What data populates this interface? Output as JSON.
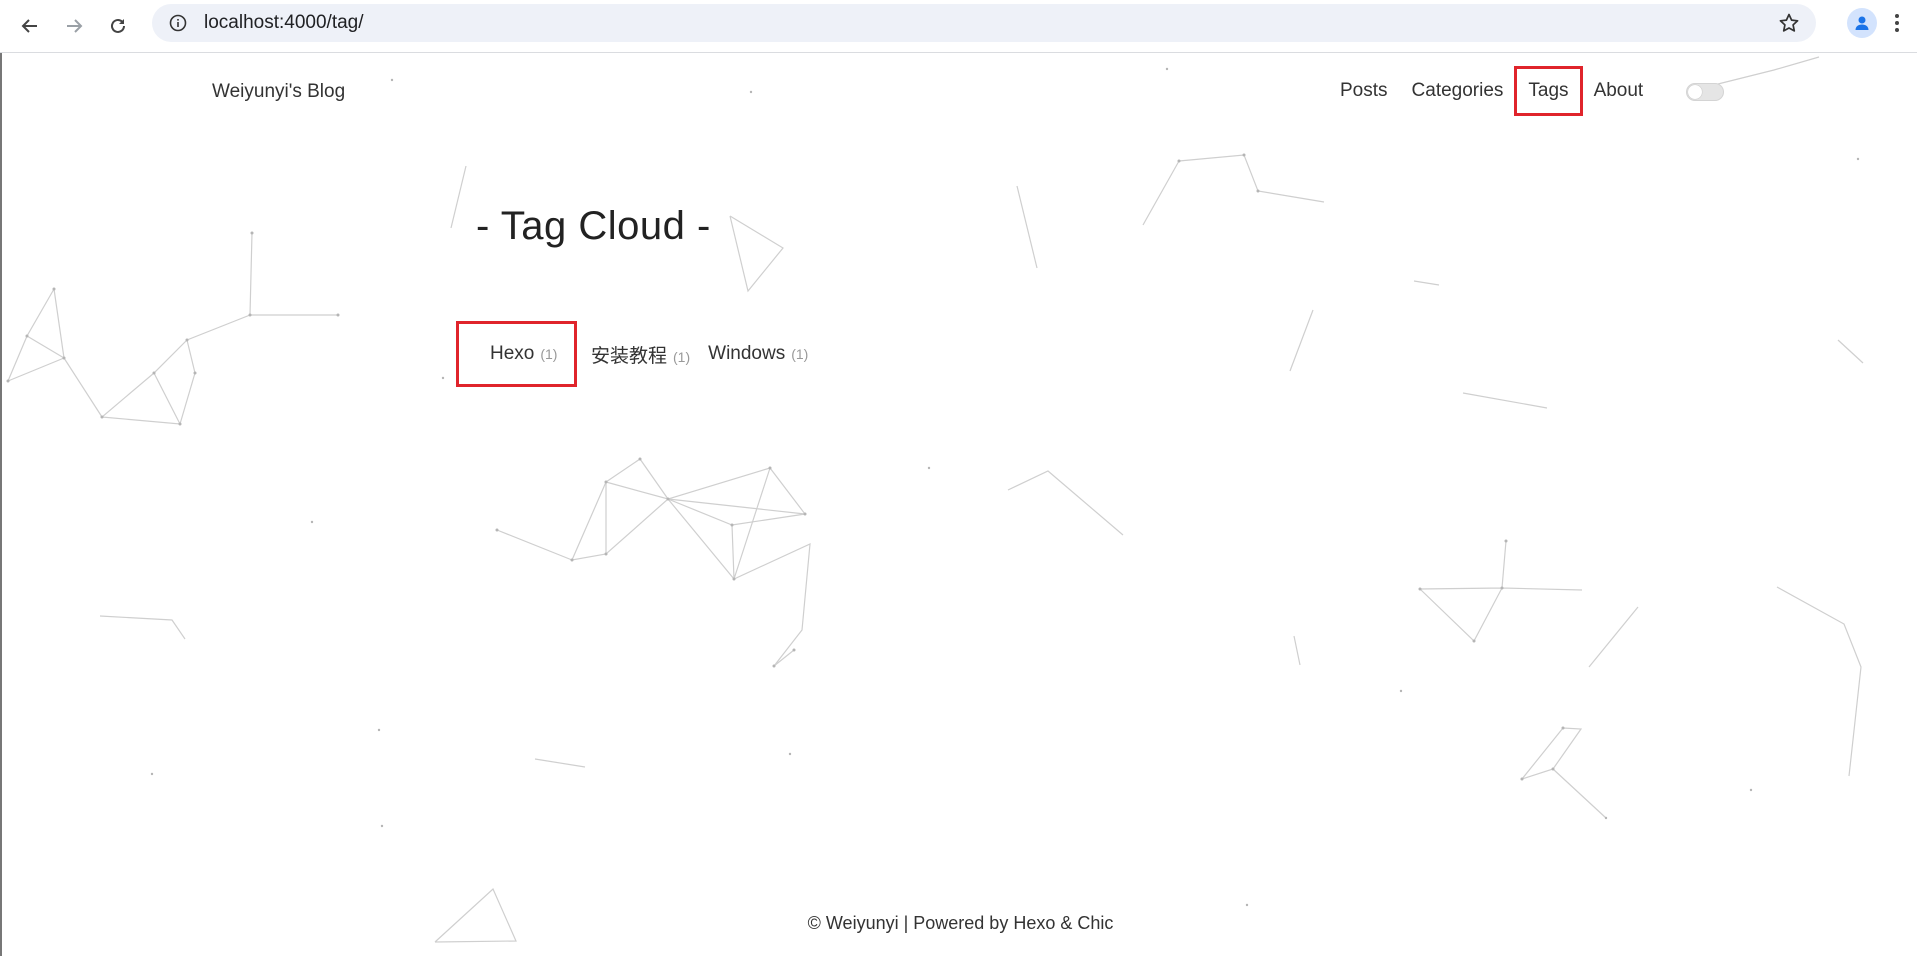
{
  "browser": {
    "url": "localhost:4000/tag/",
    "back_icon": "arrow-left-icon",
    "forward_icon": "arrow-right-icon",
    "reload_icon": "reload-icon",
    "site_info_icon": "info-icon",
    "bookmark_icon": "star-icon",
    "profile_icon": "person-icon",
    "menu_icon": "kebab-menu-icon"
  },
  "header": {
    "blog_title": "Weiyunyi's Blog",
    "nav": [
      {
        "label": "Posts"
      },
      {
        "label": "Categories"
      },
      {
        "label": "Tags",
        "highlighted": true
      },
      {
        "label": "About"
      }
    ],
    "dark_mode_toggle": {
      "on": false
    }
  },
  "main": {
    "heading": "- Tag Cloud -",
    "tags": [
      {
        "name": "Hexo",
        "count": "(1)",
        "highlighted": true
      },
      {
        "name": "安装教程",
        "count": "(1)"
      },
      {
        "name": "Windows",
        "count": "(1)"
      }
    ]
  },
  "footer": {
    "text": "© Weiyunyi | Powered by Hexo & Chic"
  },
  "colors": {
    "highlight_box": "#e0242b",
    "text": "#333333",
    "count": "#999999",
    "background": "#ffffff"
  }
}
